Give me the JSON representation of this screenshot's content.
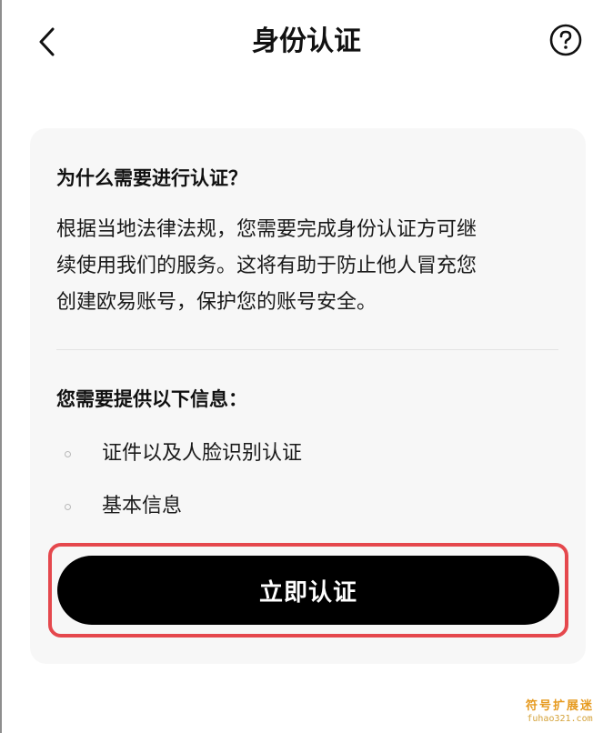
{
  "header": {
    "title": "身份认证",
    "back_icon": "chevron-left-icon",
    "help_icon": "question-circle-icon"
  },
  "card": {
    "why_title": "为什么需要进行认证？",
    "why_body_lines": [
      "根据当地法律法规，您需要完成身份认证方可继",
      "续使用我们的服务。这将有助于防止他人冒充您",
      "创建欧易账号，保护您的账号安全。"
    ],
    "need_title": "您需要提供以下信息：",
    "requirements": [
      "证件以及人脸识别认证",
      "基本信息"
    ],
    "verify_button": "立即认证"
  },
  "watermark": {
    "cn": "符号扩展迷",
    "en": "fuhao321.com"
  },
  "colors": {
    "button_bg": "#000000",
    "highlight_border": "#e5484d",
    "card_bg": "#f7f7f7",
    "watermark": "#e69a1f"
  }
}
